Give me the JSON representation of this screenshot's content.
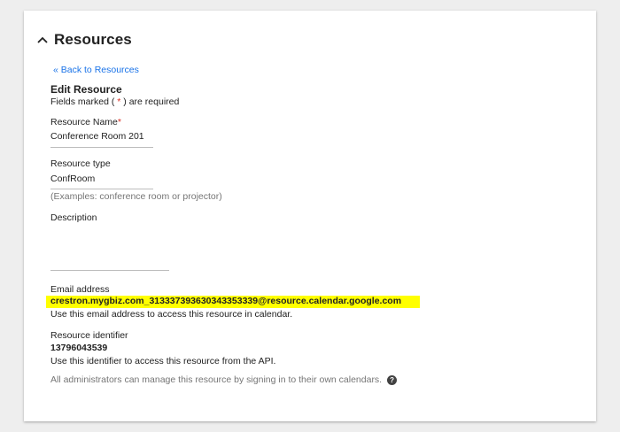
{
  "card": {
    "title": "Resources",
    "collapse_icon": "chevron-up-icon"
  },
  "form": {
    "back_link": "« Back to Resources",
    "title": "Edit Resource",
    "required_note_prefix": "Fields marked ( ",
    "required_star": "*",
    "required_note_suffix": " ) are required",
    "resource_name": {
      "label": "Resource Name",
      "required_marker": "*",
      "value": "Conference Room 201"
    },
    "resource_type": {
      "label": "Resource type",
      "value": "ConfRoom",
      "hint": "(Examples: conference room or projector)"
    },
    "description": {
      "label": "Description",
      "value": ""
    },
    "email": {
      "label": "Email address",
      "value": "crestron.mygbiz.com_313337393630343353339@resource.calendar.google.com",
      "hint": "Use this email address to access this resource in calendar.",
      "highlight_color": "#ffff00"
    },
    "identifier": {
      "label": "Resource identifier",
      "value": "13796043539",
      "hint": "Use this identifier to access this resource from the API."
    },
    "admin_note": "All administrators can manage this resource by signing in to their own calendars.",
    "help_icon": "help-circle-icon"
  }
}
